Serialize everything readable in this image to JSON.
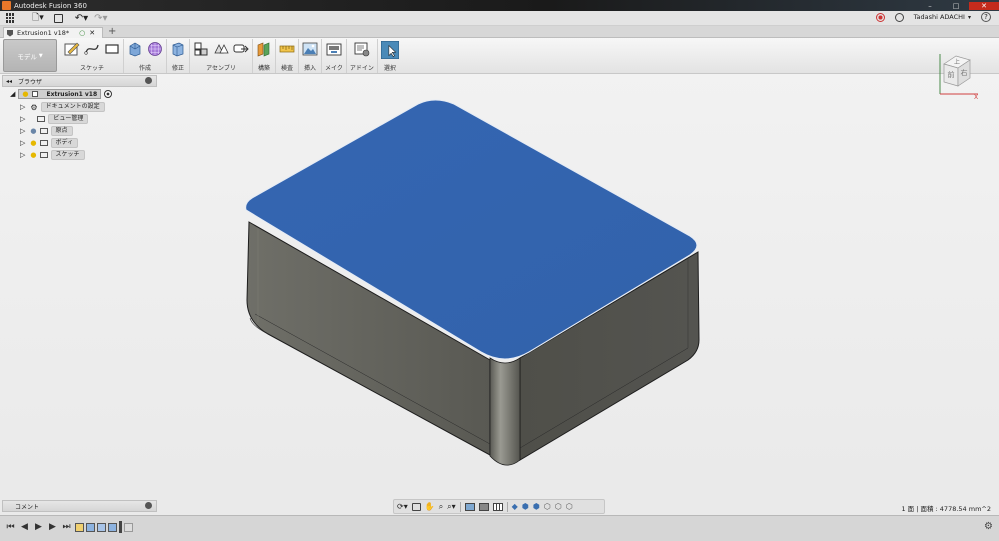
{
  "app": {
    "title": "Autodesk Fusion 360"
  },
  "document": {
    "tab_label": "Extrusion1 v18*"
  },
  "user": {
    "name": "Tadashi ADACHI"
  },
  "ribbon": {
    "workspace": "モデル",
    "groups": [
      "スケッチ",
      "作成",
      "修正",
      "アセンブリ",
      "構築",
      "検査",
      "挿入",
      "メイク",
      "アドイン",
      "選択"
    ]
  },
  "browser": {
    "title": "ブラウザ",
    "root": "Extrusion1 v18",
    "items": [
      "ドキュメントの設定",
      "ビュー管理",
      "原点",
      "ボディ",
      "スケッチ"
    ]
  },
  "comment_panel": {
    "title": "コメント"
  },
  "viewcube": {
    "top": "上",
    "front": "前",
    "right": "右"
  },
  "status": {
    "selection": "1 面 | 面積 : 4778.54 mm^2"
  },
  "colors": {
    "face_selected": "#3465b0",
    "body": "#5f5f58",
    "accent_active": "#4a8ab8"
  }
}
